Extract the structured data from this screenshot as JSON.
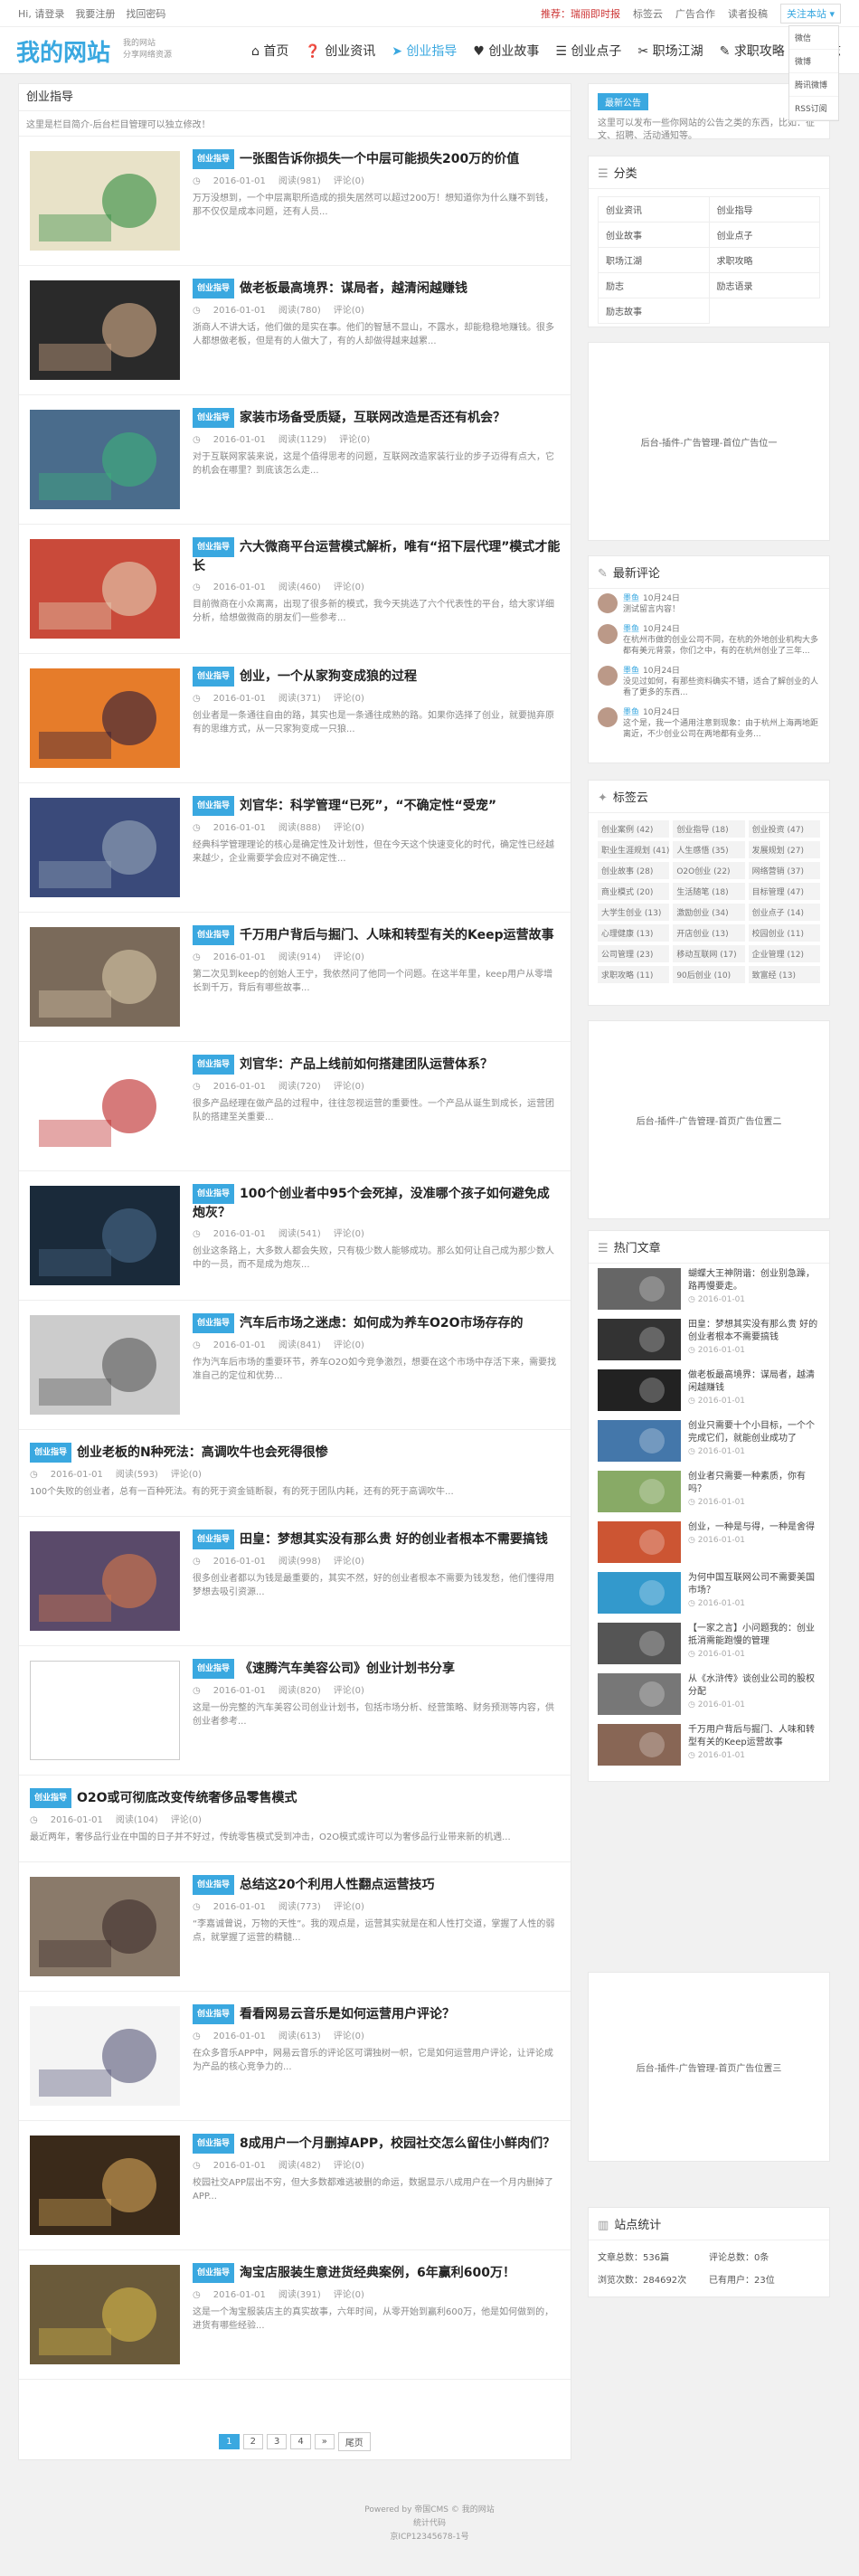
{
  "topbar": {
    "greeting": "Hi, 请登录",
    "register": "我要注册",
    "find_pw": "找回密码",
    "hot": "推荐：瑞丽即时报",
    "t1": "标签云",
    "t2": "广告合作",
    "t3": "读者投稿",
    "follow": "关注本站 ▾"
  },
  "follow_menu": [
    "微信",
    "微博",
    "腾讯微博",
    "RSS订阅"
  ],
  "site": {
    "logo": "我的网站",
    "slogan1": "我的网站",
    "slogan2": "分享网络资源"
  },
  "nav": [
    "首页",
    "创业资讯",
    "创业指导",
    "创业故事",
    "创业点子",
    "职场江湖",
    "求职攻略",
    "励志"
  ],
  "main": {
    "heading": "创业指导",
    "desc": "这里是栏目简介-后台栏目管理可以独立修改！"
  },
  "articles": [
    {
      "tag": "创业指导",
      "title": "一张图告诉你损失一个中层可能损失200万的价值",
      "date": "2016-01-01",
      "views": "阅读(981)",
      "comments": "评论(0)",
      "excerpt": "万万没想到，一个中层离职所造成的损失居然可以超过200万！想知道你为什么赚不到钱，那不仅仅是成本问题，还有人员..."
    },
    {
      "tag": "创业指导",
      "title": "做老板最高境界：谋局者，越清闲越赚钱",
      "date": "2016-01-01",
      "views": "阅读(780)",
      "comments": "评论(0)",
      "excerpt": "浙商人不讲大话，他们做的是实在事。他们的智慧不显山，不露水，却能稳稳地赚钱。很多人都想做老板，但是有的人做大了，有的人却做得越来越累..."
    },
    {
      "tag": "创业指导",
      "title": "家装市场备受质疑，互联网改造是否还有机会？",
      "date": "2016-01-01",
      "views": "阅读(1129)",
      "comments": "评论(0)",
      "excerpt": "对于互联网家装来说，这是个值得思考的问题，互联网改造家装行业的步子迈得有点大，它的机会在哪里？到底该怎么走..."
    },
    {
      "tag": "创业指导",
      "title": "六大微商平台运营模式解析，唯有“招下层代理”模式才能长",
      "date": "2016-01-01",
      "views": "阅读(460)",
      "comments": "评论(0)",
      "excerpt": "目前微商在小众离离，出现了很多新的模式，我今天挑选了六个代表性的平台，给大家详细分析，给想做微商的朋友们一些参考..."
    },
    {
      "tag": "创业指导",
      "title": "创业，一个从家狗变成狼的过程",
      "date": "2016-01-01",
      "views": "阅读(371)",
      "comments": "评论(0)",
      "excerpt": "创业者是一条通往自由的路，其实也是一条通往成熟的路。如果你选择了创业，就要抛弃原有的思维方式，从一只家狗变成一只狼..."
    },
    {
      "tag": "创业指导",
      "title": "刘官华：科学管理“已死”，“不确定性“受宠”",
      "date": "2016-01-01",
      "views": "阅读(888)",
      "comments": "评论(0)",
      "excerpt": "经典科学管理理论的核心是确定性及计划性，但在今天这个快速变化的时代，确定性已经越来越少，企业需要学会应对不确定性..."
    },
    {
      "tag": "创业指导",
      "title": "千万用户背后与掘门、人味和转型有关的Keep运营故事",
      "date": "2016-01-01",
      "views": "阅读(914)",
      "comments": "评论(0)",
      "excerpt": "第二次见到keep的创始人王宁，我依然问了他同一个问题。在这半年里，keep用户从零增长到千万，背后有哪些故事..."
    },
    {
      "tag": "创业指导",
      "title": "刘官华：产品上线前如何搭建团队运营体系？",
      "date": "2016-01-01",
      "views": "阅读(720)",
      "comments": "评论(0)",
      "excerpt": "很多产品经理在做产品的过程中，往往忽视运营的重要性。一个产品从诞生到成长，运营团队的搭建至关重要..."
    },
    {
      "tag": "创业指导",
      "title": "100个创业者中95个会死掉，没准哪个孩子如何避免成炮灰？",
      "date": "2016-01-01",
      "views": "阅读(541)",
      "comments": "评论(0)",
      "excerpt": "创业这条路上，大多数人都会失败，只有极少数人能够成功。那么如何让自己成为那少数人中的一员，而不是成为炮灰..."
    },
    {
      "tag": "创业指导",
      "title": "汽车后市场之迷虑：如何成为养车O2O市场存存的",
      "date": "2016-01-01",
      "views": "阅读(841)",
      "comments": "评论(0)",
      "excerpt": "作为汽车后市场的重要环节，养车O2O如今竞争激烈，想要在这个市场中存活下来，需要找准自己的定位和优势..."
    },
    {
      "tag": "创业指导",
      "title": "创业老板的N种死法：高调吹牛也会死得很惨",
      "date": "2016-01-01",
      "views": "阅读(593)",
      "comments": "评论(0)",
      "excerpt": "100个失败的创业者，总有一百种死法。有的死于资金链断裂，有的死于团队内耗，还有的死于高调吹牛..."
    },
    {
      "tag": "创业指导",
      "title": "田皇：梦想其实没有那么贵 好的创业者根本不需要搞钱",
      "date": "2016-01-01",
      "views": "阅读(998)",
      "comments": "评论(0)",
      "excerpt": "很多创业者都以为钱是最重要的，其实不然，好的创业者根本不需要为钱发愁，他们懂得用梦想去吸引资源..."
    },
    {
      "tag": "创业指导",
      "title": "《速腾汽车美容公司》创业计划书分享",
      "date": "2016-01-01",
      "views": "阅读(820)",
      "comments": "评论(0)",
      "excerpt": "这是一份完整的汽车美容公司创业计划书，包括市场分析、经营策略、财务预测等内容，供创业者参考..."
    },
    {
      "tag": "创业指导",
      "title": "O2O或可彻底改变传统奢侈品零售模式",
      "date": "2016-01-01",
      "views": "阅读(104)",
      "comments": "评论(0)",
      "excerpt": "最近两年，奢侈品行业在中国的日子并不好过，传统零售模式受到冲击，O2O模式或许可以为奢侈品行业带来新的机遇..."
    },
    {
      "tag": "创业指导",
      "title": "总结这20个利用人性翻点运营技巧",
      "date": "2016-01-01",
      "views": "阅读(773)",
      "comments": "评论(0)",
      "excerpt": "“李嘉诚曾说，万物的天性”。我的观点是，运营其实就是在和人性打交道，掌握了人性的弱点，就掌握了运营的精髓..."
    },
    {
      "tag": "创业指导",
      "title": "看看网易云音乐是如何运营用户评论？",
      "date": "2016-01-01",
      "views": "阅读(613)",
      "comments": "评论(0)",
      "excerpt": "在众多音乐APP中，网易云音乐的评论区可谓独树一帜，它是如何运营用户评论，让评论成为产品的核心竞争力的..."
    },
    {
      "tag": "创业指导",
      "title": "8成用户一个月删掉APP，校园社交怎么留住小鲜肉们？",
      "date": "2016-01-01",
      "views": "阅读(482)",
      "comments": "评论(0)",
      "excerpt": "校园社交APP层出不穷，但大多数都难逃被删的命运，数据显示八成用户在一个月内删掉了APP..."
    },
    {
      "tag": "创业指导",
      "title": "淘宝店服装生意进货经典案例，6年赢利600万！",
      "date": "2016-01-01",
      "views": "阅读(391)",
      "comments": "评论(0)",
      "excerpt": "这是一个淘宝服装店主的真实故事，六年时间，从零开始到赢利600万，他是如何做到的，进货有哪些经验..."
    }
  ],
  "pager": [
    "1",
    "2",
    "3",
    "4",
    "»",
    "尾页"
  ],
  "sidebar": {
    "notice_tag": "最新公告",
    "notice_text": "这里可以发布一些你网站的公告之类的东西，比如：征文、招聘、活动通知等。",
    "cat_title": "分类",
    "cats": [
      "创业资讯",
      "创业指导",
      "创业故事",
      "创业点子",
      "职场江湖",
      "求职攻略",
      "励志",
      "励志语录",
      "励志故事"
    ],
    "ad1": "后台-插件-广告管理-首位广告位一",
    "cmt_title": "最新评论",
    "comments": [
      {
        "name": "墨鱼",
        "time": "10月24日",
        "text": "测试留言内容！"
      },
      {
        "name": "墨鱼",
        "time": "10月24日",
        "text": "在杭州市做的创业公司不同，在杭的外地创业机构大多都有美元背景，你们之中，有的在杭州创业了三年..."
      },
      {
        "name": "墨鱼",
        "time": "10月24日",
        "text": "没见过如何，有那些资料确实不错，适合了解创业的人看了更多的东西..."
      },
      {
        "name": "墨鱼",
        "time": "10月24日",
        "text": "这个是，我一个通用注意到现象：由于杭州上海两地距离近，不少创业公司在两地都有业务..."
      }
    ],
    "tag_title": "标签云",
    "tags": [
      "创业案例 (42)",
      "创业指导 (18)",
      "创业投资 (47)",
      "职业生涯规划 (41)",
      "人生感悟 (35)",
      "发展规划 (27)",
      "创业故事 (28)",
      "O2O创业 (22)",
      "网络营销 (37)",
      "商业模式 (20)",
      "生活随笔 (18)",
      "目标管理 (47)",
      "大学生创业 (13)",
      "激励创业 (34)",
      "创业点子 (14)",
      "心理健康 (13)",
      "开店创业 (13)",
      "校园创业 (11)",
      "公司管理 (23)",
      "移动互联网 (17)",
      "企业管理 (12)",
      "求职攻略 (11)",
      "90后创业 (10)",
      "致富经 (13)"
    ],
    "ad2": "后台-插件-广告管理-首页广告位置二",
    "hot_title": "热门文章",
    "hot": [
      {
        "title": "蝴蝶大王神阴谐：创业别急躁，路再慢要走。",
        "date": "2016-01-01"
      },
      {
        "title": "田皇：梦想其实没有那么贵 好的创业者根本不需要搞钱",
        "date": "2016-01-01"
      },
      {
        "title": "做老板最高境界：谋局者，越清闲越赚钱",
        "date": "2016-01-01"
      },
      {
        "title": "创业只需要十个小目标，一个个完成它们，就能创业成功了",
        "date": "2016-01-01"
      },
      {
        "title": "创业者只需要一种素质，你有吗？",
        "date": "2016-01-01"
      },
      {
        "title": "创业，一种是与得，一种是舍得",
        "date": "2016-01-01"
      },
      {
        "title": "为何中国互联网公司不需要美国市场？",
        "date": "2016-01-01"
      },
      {
        "title": "【一家之言】小问题我的：创业抵消需能跑慢的管理",
        "date": "2016-01-01"
      },
      {
        "title": "从《水浒传》谈创业公司的股权分配",
        "date": "2016-01-01"
      },
      {
        "title": "千万用户背后与掘门、人味和转型有关的Keep运营故事",
        "date": "2016-01-01"
      }
    ],
    "ad3": "后台-插件-广告管理-首页广告位置三",
    "stat_title": "站点统计",
    "stats": [
      "文章总数：536篇",
      "评论总数：0条",
      "浏览次数：284692次",
      "已有用户：23位"
    ]
  },
  "footer": {
    "l1": "Powered by 帝国CMS © 我的网站",
    "l2": "统计代码",
    "l3": "京ICP12345678-1号"
  },
  "colors": {
    "accent": "#3aa8e0"
  }
}
